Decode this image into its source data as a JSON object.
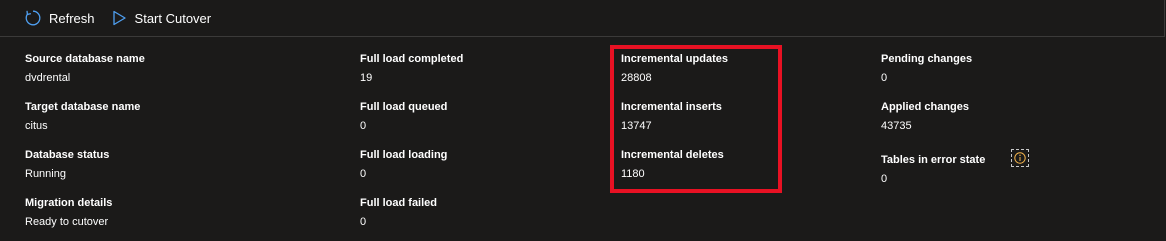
{
  "toolbar": {
    "refresh_label": "Refresh",
    "cutover_label": "Start Cutover",
    "refresh_icon": "refresh-icon",
    "cutover_icon": "play-icon",
    "accent_color": "#4f9ff0"
  },
  "details": {
    "source_db": {
      "label": "Source database name",
      "value": "dvdrental"
    },
    "target_db": {
      "label": "Target database name",
      "value": "citus"
    },
    "db_status": {
      "label": "Database status",
      "value": "Running"
    },
    "migration": {
      "label": "Migration details",
      "value": "Ready to cutover"
    }
  },
  "full_load": {
    "completed": {
      "label": "Full load completed",
      "value": "19"
    },
    "queued": {
      "label": "Full load queued",
      "value": "0"
    },
    "loading": {
      "label": "Full load loading",
      "value": "0"
    },
    "failed": {
      "label": "Full load failed",
      "value": "0"
    }
  },
  "incremental": {
    "updates": {
      "label": "Incremental updates",
      "value": "28808"
    },
    "inserts": {
      "label": "Incremental inserts",
      "value": "13747"
    },
    "deletes": {
      "label": "Incremental deletes",
      "value": "1180"
    },
    "highlight_color": "#e81123"
  },
  "changes": {
    "pending": {
      "label": "Pending changes",
      "value": "0"
    },
    "applied": {
      "label": "Applied changes",
      "value": "43735"
    },
    "errors": {
      "label": "Tables in error state",
      "value": "0",
      "icon": "info-icon"
    }
  }
}
